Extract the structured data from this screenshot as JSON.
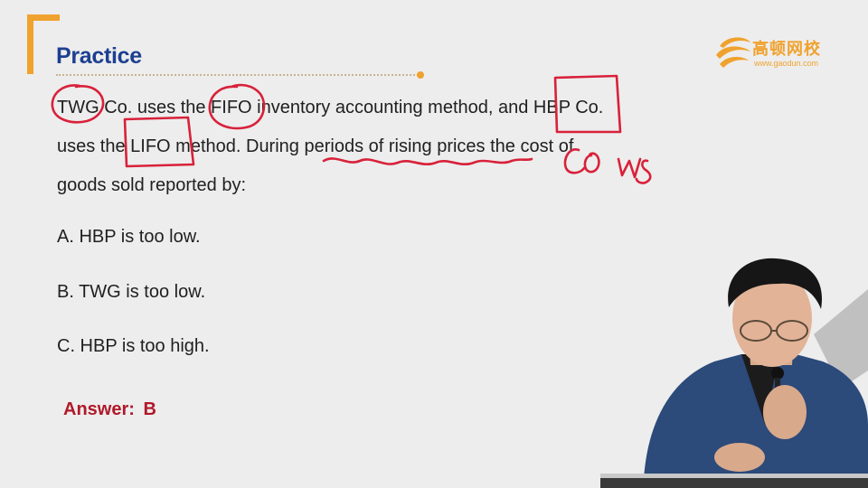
{
  "header": {
    "title": "Practice",
    "logo_cn": "高顿网校",
    "logo_url": "www.gaodun.com"
  },
  "question": {
    "line1": "TWG Co. uses the FIFO inventory accounting method, and HBP Co.",
    "line2": "uses the LIFO method. During periods of rising prices the cost of",
    "line3": "goods sold reported by:"
  },
  "options": [
    {
      "text": "A. HBP is too low."
    },
    {
      "text": "B. TWG is too low."
    },
    {
      "text": "C. HBP is too high."
    }
  ],
  "answer": {
    "label": "Answer:",
    "value": "B"
  },
  "colors": {
    "accent_orange": "#f0a22e",
    "title_blue": "#1d3f91",
    "answer_red": "#b0192a",
    "annotation_red": "#d8213a"
  }
}
